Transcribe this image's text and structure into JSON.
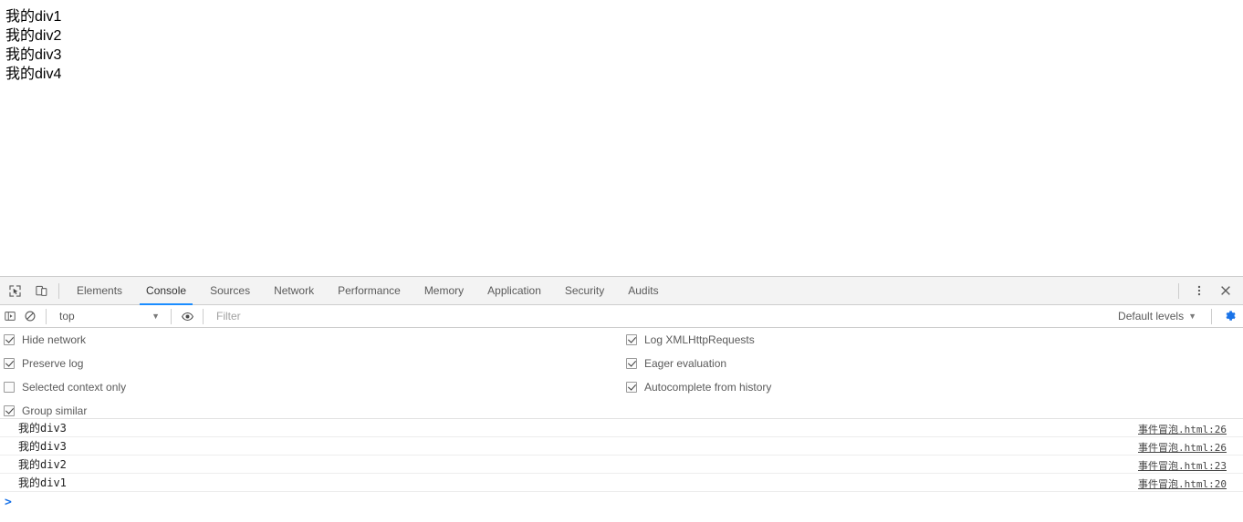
{
  "page": {
    "lines": [
      "我的div1",
      "我的div2",
      "我的div3",
      "我的div4"
    ]
  },
  "devtools": {
    "left_icons": [
      {
        "name": "inspect-element-icon",
        "title": "Inspect element"
      },
      {
        "name": "device-toolbar-icon",
        "title": "Toggle device toolbar"
      }
    ],
    "tabs": [
      {
        "label": "Elements",
        "active": false
      },
      {
        "label": "Console",
        "active": true
      },
      {
        "label": "Sources",
        "active": false
      },
      {
        "label": "Network",
        "active": false
      },
      {
        "label": "Performance",
        "active": false
      },
      {
        "label": "Memory",
        "active": false
      },
      {
        "label": "Application",
        "active": false
      },
      {
        "label": "Security",
        "active": false
      },
      {
        "label": "Audits",
        "active": false
      }
    ],
    "tabbar_right": [
      {
        "name": "more-options-icon",
        "glyph": "⋮"
      },
      {
        "name": "close-devtools-icon",
        "glyph": "✕"
      }
    ],
    "toolbar": {
      "sidebar_toggle": "console-sidebar-toggle-icon",
      "clear_console": "clear-console-icon",
      "context": "top",
      "context_caret": "▼",
      "live_expression": "eye-icon",
      "filter_placeholder": "Filter",
      "filter_value": "",
      "levels_label": "Default levels",
      "levels_caret": "▼",
      "settings": "gear-icon"
    },
    "settings": {
      "left": [
        {
          "label": "Hide network",
          "checked": true
        },
        {
          "label": "Preserve log",
          "checked": true
        },
        {
          "label": "Selected context only",
          "checked": false
        },
        {
          "label": "Group similar",
          "checked": true
        }
      ],
      "right": [
        {
          "label": "Log XMLHttpRequests",
          "checked": true
        },
        {
          "label": "Eager evaluation",
          "checked": true
        },
        {
          "label": "Autocomplete from history",
          "checked": true
        }
      ]
    },
    "messages": [
      {
        "text": "我的div3",
        "source": "事件冒泡.html:26"
      },
      {
        "text": "我的div3",
        "source": "事件冒泡.html:26"
      },
      {
        "text": "我的div2",
        "source": "事件冒泡.html:23"
      },
      {
        "text": "我的div1",
        "source": "事件冒泡.html:20"
      }
    ],
    "prompt": {
      "chevron": ">",
      "value": ""
    }
  },
  "colors": {
    "accent": "#1a8cff",
    "prompt": "#1a73e8",
    "gear_active": "#1a73e8",
    "toolbar_bg": "#f3f3f3",
    "border": "#cdcdcd"
  }
}
